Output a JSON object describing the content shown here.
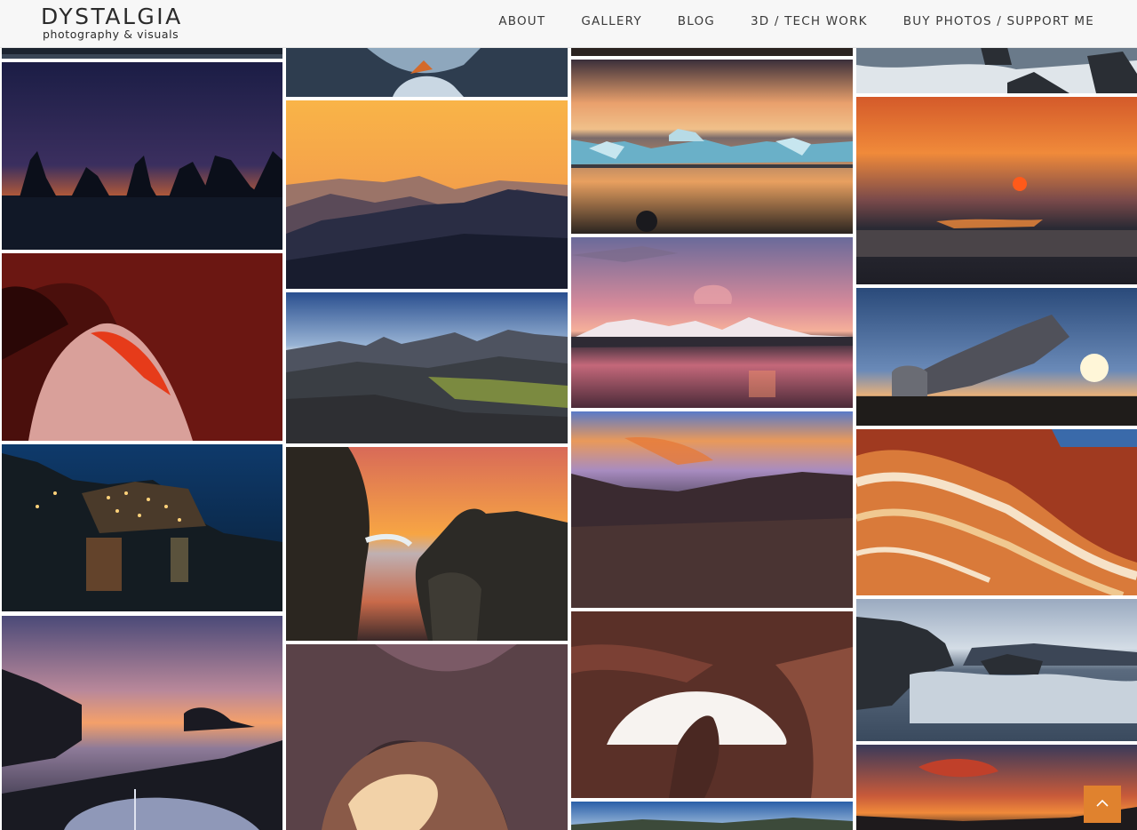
{
  "site": {
    "logo_title": "DYSTALGIA",
    "logo_subtitle": "photography & visuals"
  },
  "nav": {
    "items": [
      {
        "label": "ABOUT"
      },
      {
        "label": "GALLERY"
      },
      {
        "label": "BLOG"
      },
      {
        "label": "3D / TECH WORK"
      },
      {
        "label": "BUY PHOTOS / SUPPORT ME"
      }
    ]
  },
  "gallery": {
    "photos": [
      {
        "name": "sea-stacks-sunset-photo"
      },
      {
        "name": "slot-canyon-red-photo"
      },
      {
        "name": "coastal-village-night-photo"
      },
      {
        "name": "coast-dusk-boat-photo"
      },
      {
        "name": "ice-shore-photo"
      },
      {
        "name": "golden-mountain-haze-photo"
      },
      {
        "name": "highland-mountains-photo"
      },
      {
        "name": "rocky-coast-sunset-photo"
      },
      {
        "name": "canyon-arch-glow-photo"
      },
      {
        "name": "glacier-lagoon-photo-top"
      },
      {
        "name": "glacier-lagoon-sunset-photo"
      },
      {
        "name": "pink-mountain-beach-photo"
      },
      {
        "name": "volcanic-desert-sunset-photo"
      },
      {
        "name": "antelope-canyon-photo"
      },
      {
        "name": "blue-sky-valley-photo"
      },
      {
        "name": "surf-rocks-photo"
      },
      {
        "name": "sunset-sun-beach-photo"
      },
      {
        "name": "plane-wreck-sunset-photo"
      },
      {
        "name": "wave-rock-formation-photo"
      },
      {
        "name": "stormy-sea-photo"
      },
      {
        "name": "red-sky-dusk-photo"
      }
    ]
  },
  "scroll_top": {
    "icon": "chevron-up-icon"
  }
}
